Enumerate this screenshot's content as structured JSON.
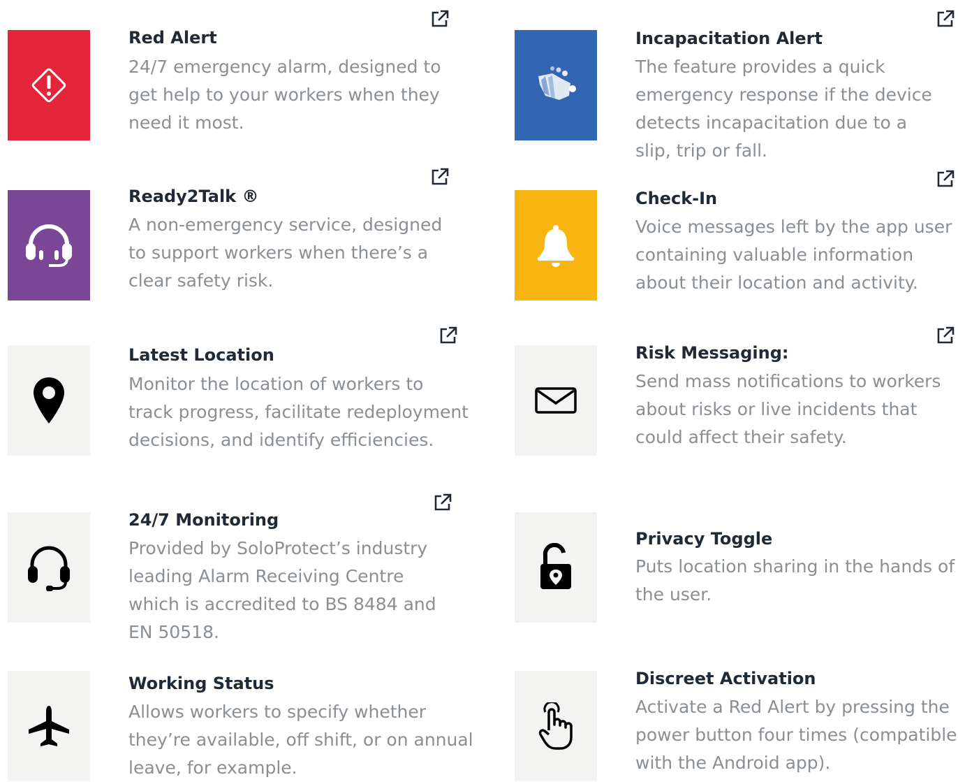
{
  "colors": {
    "red": "#e42439",
    "blue": "#3266b3",
    "purple": "#7a4797",
    "yellow": "#f8b411",
    "grey_tile": "#f3f3f2",
    "title": "#1f2a36",
    "description": "#8a8f94"
  },
  "features": [
    {
      "id": "red-alert",
      "icon": "warning-diamond-icon",
      "title": "Red Alert",
      "lines": [
        "24/7 emergency alarm, designed to",
        "get help to your workers when they",
        "need it most."
      ],
      "external_link": true
    },
    {
      "id": "incapacitation-alert",
      "icon": "fall-detection-icon",
      "title": "Incapacitation Alert",
      "lines": [
        "The feature provides a quick",
        "emergency response if the device",
        "detects incapacitation due to a",
        "slip, trip or fall."
      ],
      "external_link": true
    },
    {
      "id": "ready2talk",
      "icon": "headset-icon",
      "title": "Ready2Talk ®",
      "lines": [
        "A non-emergency service, designed",
        "to support workers when there’s a",
        "clear safety risk."
      ],
      "external_link": true
    },
    {
      "id": "check-in",
      "icon": "bell-icon",
      "title": "Check-In",
      "lines": [
        "Voice messages left by the app user",
        "containing valuable information",
        "about their location and activity."
      ],
      "external_link": true
    },
    {
      "id": "latest-location",
      "icon": "location-pin-icon",
      "title": "Latest Location",
      "lines": [
        "Monitor the location of workers to",
        "track progress, facilitate redeployment",
        "decisions, and identify efficiencies."
      ],
      "external_link": true
    },
    {
      "id": "risk-messaging",
      "icon": "envelope-icon",
      "title": "Risk Messaging:",
      "lines": [
        "Send mass notifications to workers",
        "about risks or live incidents that",
        "could affect their safety."
      ],
      "external_link": true
    },
    {
      "id": "monitoring",
      "icon": "headphones-icon",
      "title": "24/7 Monitoring",
      "lines": [
        "Provided by SoloProtect’s industry",
        "leading Alarm Receiving Centre",
        "which is accredited to BS 8484 and",
        "EN 50518."
      ],
      "external_link": true
    },
    {
      "id": "privacy-toggle",
      "icon": "unlocked-padlock-icon",
      "title": "Privacy Toggle",
      "lines": [
        "Puts location sharing in the hands of",
        "the user."
      ],
      "external_link": false
    },
    {
      "id": "working-status",
      "icon": "airplane-icon",
      "title": "Working Status",
      "lines": [
        "Allows workers to specify whether",
        "they’re available, off shift, or on annual",
        "leave, for example."
      ],
      "external_link": false
    },
    {
      "id": "discreet-activation",
      "icon": "pointing-hand-icon",
      "title": "Discreet Activation",
      "lines": [
        "Activate a Red Alert by pressing the",
        "power button four times (compatible",
        "with the Android app)."
      ],
      "external_link": false
    }
  ]
}
